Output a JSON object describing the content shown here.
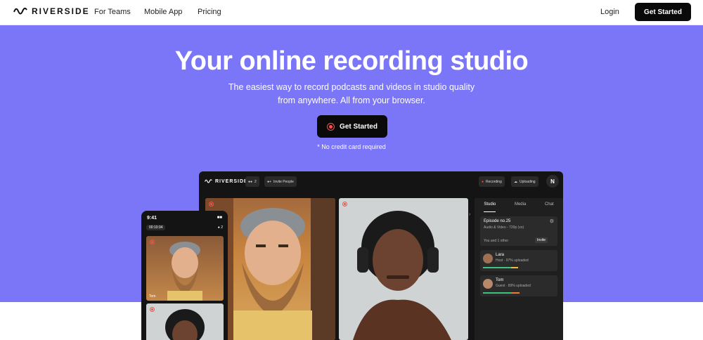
{
  "nav": {
    "logo": "RIVERSIDE",
    "links": [
      "For Teams",
      "Mobile App",
      "Pricing"
    ],
    "login": "Login",
    "cta": "Get Started"
  },
  "hero": {
    "title": "Your online recording studio",
    "subtitle_line1": "The easiest way to record podcasts and videos in studio quality",
    "subtitle_line2": "from anywhere. All from your browser.",
    "cta": "Get Started",
    "note": "* No credit card required",
    "bg_color": "#7b75f7"
  },
  "studio": {
    "logo": "RIVERSIDE",
    "participant_count": "2",
    "invite": "Invite People",
    "recording": "Recording",
    "uploading": "Uploading",
    "avatar": "N",
    "tabs": [
      "Studio",
      "Media",
      "Chat"
    ],
    "episode_title": "Episode no.25",
    "episode_meta": "Audio & Video - 720p (vo)",
    "you_and_others": "You and 1 other",
    "invite_small": "Invite",
    "guests": [
      {
        "name": "Lara",
        "status": "Host · 97% uploaded"
      },
      {
        "name": "Tom",
        "status": "Guest · 89% uploaded"
      }
    ]
  },
  "phone": {
    "time": "9:41",
    "timer": "00:10:34",
    "count": "2",
    "guest_label": "Tom"
  }
}
